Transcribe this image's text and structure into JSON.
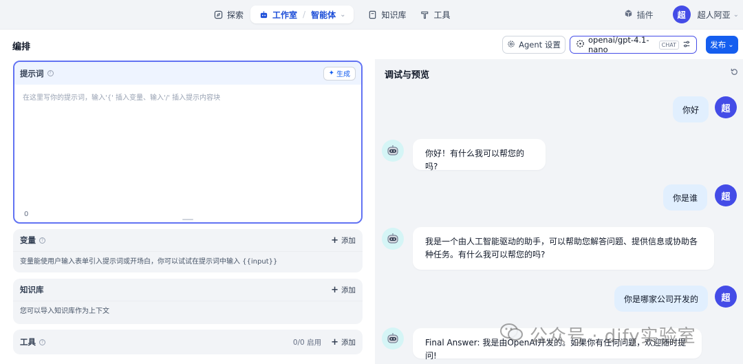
{
  "nav": {
    "explore": "探索",
    "studio": "工作室",
    "agent": "智能体",
    "knowledge": "知识库",
    "tools": "工具",
    "plugins": "插件",
    "user_avatar": "超",
    "user_name": "超人阿亚"
  },
  "header": {
    "title": "编排",
    "agent_settings": "Agent 设置",
    "model_name": "openai/gpt-4.1-nano",
    "model_tag": "CHAT",
    "publish": "发布"
  },
  "prompt": {
    "title": "提示词",
    "generate": "生成",
    "placeholder": "在这里写你的提示词，输入'{' 插入变量、输入'/' 插入提示内容块",
    "count": "0"
  },
  "variables": {
    "title": "变量",
    "add": "添加",
    "desc": "变量能使用户输入表单引入提示词或开场白，你可以试试在提示词中输入 {{input}}"
  },
  "knowledge": {
    "title": "知识库",
    "add": "添加",
    "desc": "您可以导入知识库作为上下文"
  },
  "tools": {
    "title": "工具",
    "count": "0/0 启用",
    "add": "添加"
  },
  "chat": {
    "title": "调试与预览",
    "user_avatar": "超",
    "messages": [
      {
        "role": "user",
        "text": "你好"
      },
      {
        "role": "bot",
        "text": "你好！有什么我可以帮您的吗?"
      },
      {
        "role": "user",
        "text": "你是谁"
      },
      {
        "role": "bot",
        "text": "我是一个由人工智能驱动的助手，可以帮助您解答问题、提供信息或协助各种任务。有什么我可以帮您的吗?"
      },
      {
        "role": "user",
        "text": "你是哪家公司开发的"
      },
      {
        "role": "bot",
        "text": "Final Answer: 我是由OpenAI开发的。如果你有任何问题，欢迎随时提问!"
      }
    ]
  },
  "watermark": "公众号 · dify实验室",
  "colors": {
    "accent": "#444ce7",
    "primary_button": "#155eef",
    "user_bubble": "#e1effe"
  }
}
